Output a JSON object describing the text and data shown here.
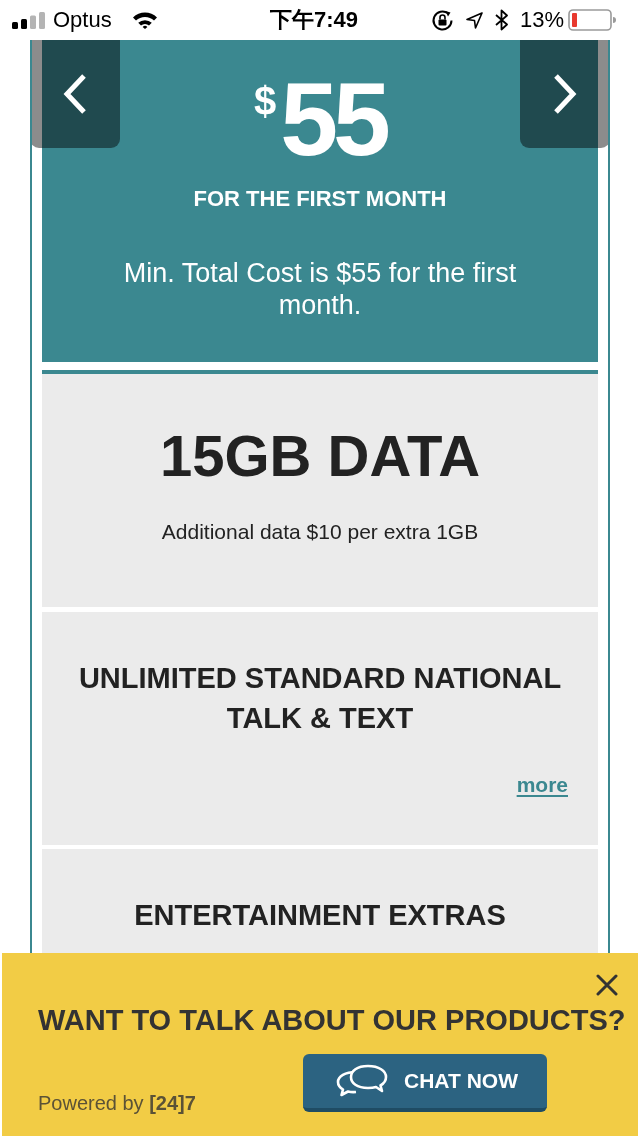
{
  "status_bar": {
    "carrier": "Optus",
    "time": "下午7:49",
    "battery_percent": "13%"
  },
  "price_panel": {
    "currency": "$",
    "amount": "55",
    "period": "FOR THE FIRST MONTH",
    "min_cost": "Min. Total Cost is $55 for the first month."
  },
  "features": [
    {
      "title": "15GB DATA",
      "detail": "Additional data $10 per extra 1GB"
    },
    {
      "title": "UNLIMITED STANDARD NATIONAL TALK & TEXT",
      "link": "more"
    },
    {
      "title": "ENTERTAINMENT EXTRAS"
    }
  ],
  "chat_banner": {
    "heading": "WANT TO TALK ABOUT OUR PRODUCTS?",
    "button": "CHAT NOW",
    "powered_by": "Powered by **[24]7**"
  }
}
